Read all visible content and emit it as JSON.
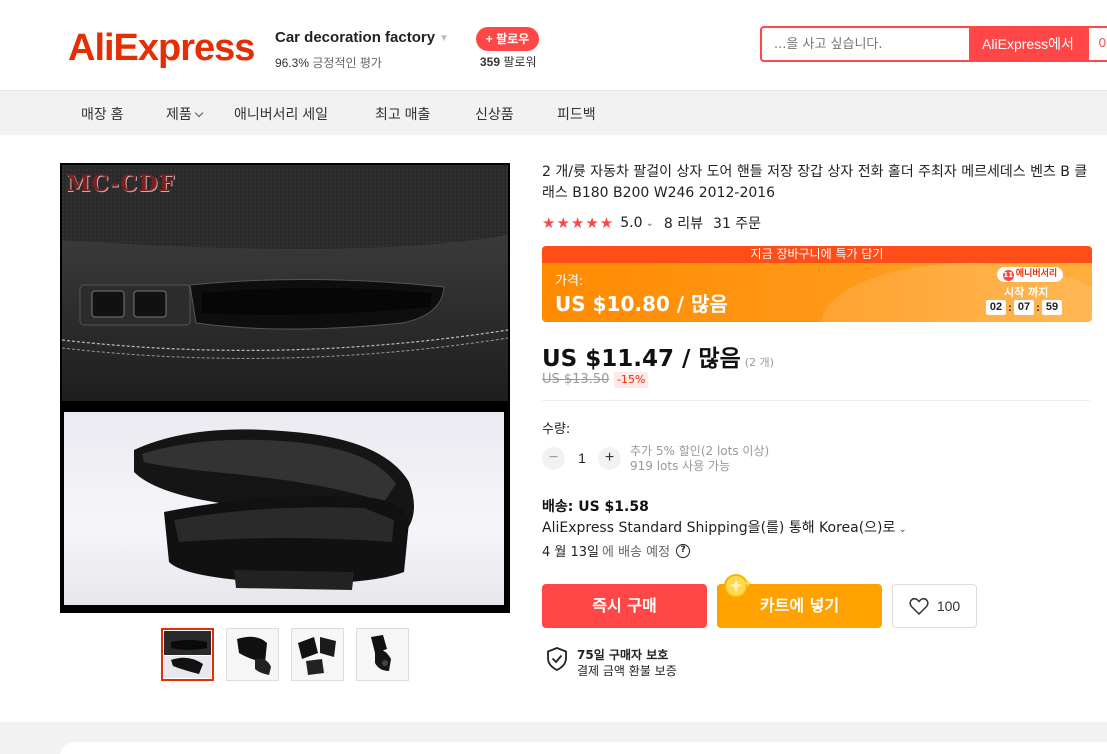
{
  "header": {
    "logo": "AliExpress",
    "store": {
      "name": "Car decoration factory",
      "rating_value": "96.3%",
      "rating_label": "긍정적인 평가",
      "follow_label": "+ 팔로우",
      "followers_count": "359",
      "followers_label": "팔로워"
    },
    "search": {
      "placeholder": "...을 사고 싶습니다.",
      "button_aliexpress": "AliExpress에서",
      "button_store": "이"
    }
  },
  "nav": {
    "items": [
      {
        "label": "매장 홈"
      },
      {
        "label": "제품"
      },
      {
        "label": "애니버서리 세일"
      },
      {
        "label": "최고 매출"
      },
      {
        "label": "신상품"
      },
      {
        "label": "피드백"
      }
    ]
  },
  "gallery": {
    "watermark": "MC-CDF",
    "thumbnail_count": 4,
    "active_thumbnail": 1
  },
  "product": {
    "title": "2 개/륫 자동차 팔걸이 상자 도어 핸들 저장 장갑 상자 전화 홀더 주최자 메르세데스 벤츠 B 클래스 B180 B200 W246 2012-2016",
    "rating": {
      "stars": 5,
      "score": "5.0",
      "reviews": "8 리뷰",
      "orders": "31 주문"
    },
    "promo": {
      "banner": "지금 장바구니에 특가 담기",
      "price_label": "가격:",
      "price": "US $10.80 / 많음",
      "badge": "애니버서리",
      "start_label": "시작 까지",
      "timer": {
        "hours": "02",
        "minutes": "07",
        "seconds": "59"
      }
    },
    "price": "US $11.47 / 많음",
    "price_qty": "(2 개)",
    "original_price": "US $13.50",
    "discount": "-15%",
    "quantity": {
      "label": "수량:",
      "value": "1",
      "minus": "−",
      "plus": "+",
      "note_line1": "추가 5% 할인(2 lots 이상)",
      "note_line2": "919 lots 사용 가능"
    },
    "shipping": {
      "price": "배송: US $1.58",
      "method": "AliExpress Standard Shipping을(를) 통해 Korea(으)로",
      "date": "4 월 13일",
      "date_suffix": "에 배송 예정",
      "help": "?"
    },
    "actions": {
      "buy_now": "즉시 구매",
      "add_to_cart": "카트에 넣기",
      "wishlist_count": "100"
    },
    "protection": {
      "title": "75일 구매자 보호",
      "subtitle": "결제 금액 환불 보증"
    }
  },
  "colors": {
    "brand": "#e62e04",
    "accent_red": "#ff4747",
    "cart_orange": "#ffa200",
    "promo_orange": "#ff8a00"
  }
}
